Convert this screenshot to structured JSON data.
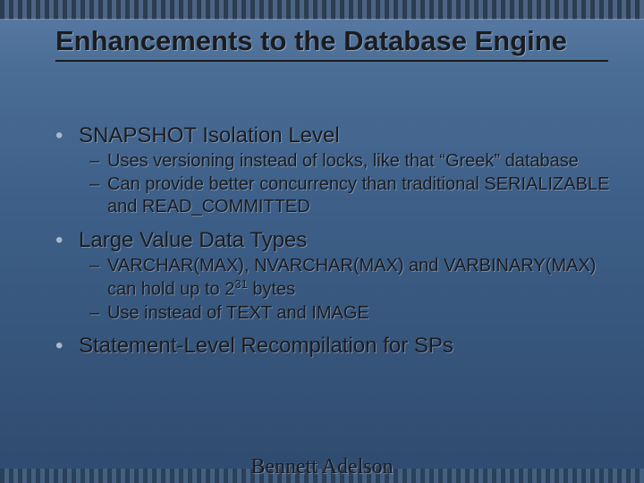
{
  "title": "Enhancements to the Database Engine",
  "bullets": [
    {
      "text": "SNAPSHOT Isolation Level",
      "sub": [
        "Uses versioning instead of locks, like that “Greek” database",
        "Can provide better concurrency than traditional  SERIALIZABLE and READ_COMMITTED"
      ]
    },
    {
      "text": "Large Value Data Types",
      "sub": [
        "VARCHAR(MAX), NVARCHAR(MAX) and VARBINARY(MAX) can hold up to 2^{31} bytes",
        "Use instead of TEXT and IMAGE"
      ]
    },
    {
      "text": "Statement-Level Recompilation for SPs",
      "sub": []
    }
  ],
  "footer": "Bennett Adelson"
}
